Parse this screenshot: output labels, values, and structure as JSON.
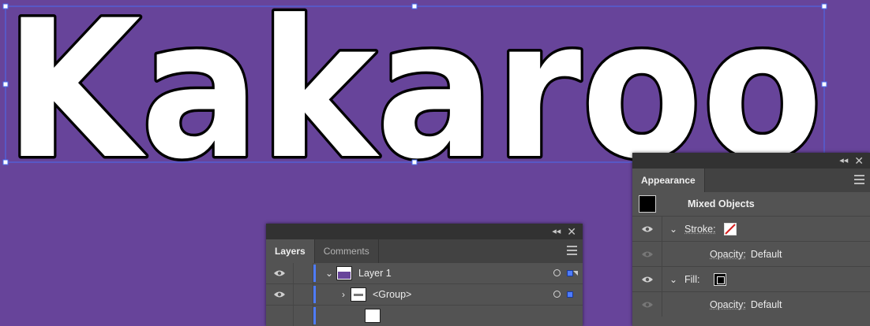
{
  "artwork": {
    "text": "Kakaroo",
    "fill_color": "#ffffff",
    "stroke_color": "#000000",
    "selection_color": "#4a6cf0"
  },
  "layers_panel": {
    "tabs": [
      {
        "label": "Layers"
      },
      {
        "label": "Comments"
      }
    ],
    "rows": [
      {
        "name": "Layer 1",
        "expanded": true
      },
      {
        "name": "<Group>",
        "expanded": false
      },
      {
        "name": ""
      }
    ]
  },
  "appearance_panel": {
    "tab_label": "Appearance",
    "header": "Mixed Objects",
    "stroke_label": "Stroke:",
    "stroke_opacity_label": "Opacity:",
    "stroke_opacity_value": "Default",
    "fill_label": "Fill:",
    "fill_opacity_label": "Opacity:",
    "fill_opacity_value": "Default"
  },
  "colors": {
    "canvas": "#67449a",
    "panel": "#535353",
    "layer_color": "#4e7cff"
  }
}
